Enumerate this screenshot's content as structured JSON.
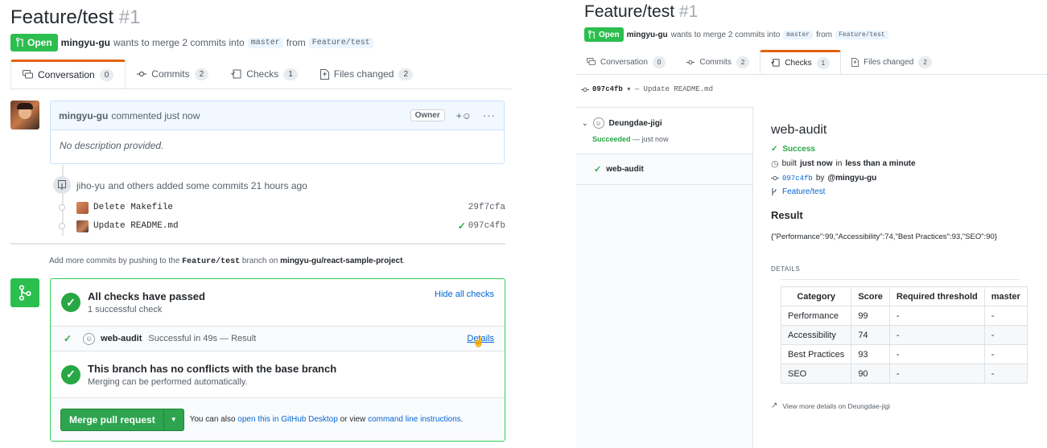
{
  "left": {
    "title": "Feature/test",
    "number": "#1",
    "state_label": "Open",
    "author": "mingyu-gu",
    "merge_text": "wants to merge 2 commits into",
    "base_branch": "master",
    "from_text": "from",
    "head_branch": "Feature/test",
    "tabs": [
      {
        "label": "Conversation",
        "count": "0"
      },
      {
        "label": "Commits",
        "count": "2"
      },
      {
        "label": "Checks",
        "count": "1"
      },
      {
        "label": "Files changed",
        "count": "2"
      }
    ],
    "comment": {
      "author": "mingyu-gu",
      "action": "commented just now",
      "owner_badge": "Owner",
      "body": "No description provided."
    },
    "commits_event": {
      "author": "jiho-yu",
      "text": "and others added some commits 21 hours ago"
    },
    "commits": [
      {
        "message": "Delete Makefile",
        "sha": "29f7cfa",
        "status": ""
      },
      {
        "message": "Update README.md",
        "sha": "097c4fb",
        "status": "success"
      }
    ],
    "push_hint": {
      "prefix": "Add more commits by pushing to the",
      "branch": "Feature/test",
      "middle": "branch on",
      "repo": "mingyu-gu/react-sample-project",
      "suffix": "."
    },
    "checks": {
      "title": "All checks have passed",
      "subtitle": "1 successful check",
      "hide_link": "Hide all checks",
      "item_name": "web-audit",
      "item_status": "Successful in 49s — Result",
      "details_link": "Details"
    },
    "conflicts": {
      "title": "This branch has no conflicts with the base branch",
      "subtitle": "Merging can be performed automatically."
    },
    "merge": {
      "button": "Merge pull request",
      "also_text": "You can also",
      "desktop_link": "open this in GitHub Desktop",
      "or_text": "or view",
      "cli_link": "command line instructions",
      "end": "."
    }
  },
  "right": {
    "title": "Feature/test",
    "number": "#1",
    "state_label": "Open",
    "author": "mingyu-gu",
    "merge_text": "wants to merge 2 commits into",
    "base_branch": "master",
    "from_text": "from",
    "head_branch": "Feature/test",
    "tabs": [
      {
        "label": "Conversation",
        "count": "0"
      },
      {
        "label": "Commits",
        "count": "2"
      },
      {
        "label": "Checks",
        "count": "1"
      },
      {
        "label": "Files changed",
        "count": "2"
      }
    ],
    "commit_selector": {
      "sha": "097c4fb",
      "message": "— Update README.md"
    },
    "suite": {
      "name": "Deungdae-jigi",
      "status": "Succeeded",
      "time": "— just now"
    },
    "run_item": "web-audit",
    "detail": {
      "title": "web-audit",
      "status": "Success",
      "built_prefix": "built",
      "built_when": "just now",
      "built_in": "in",
      "built_duration": "less than a minute",
      "commit_sha": "097c4fb",
      "commit_by": "by",
      "commit_user": "@mingyu-gu",
      "branch": "Feature/test",
      "result_heading": "Result",
      "result_json": "{\"Performance\":99,\"Accessibility\":74,\"Best Practices\":93,\"SEO\":90}",
      "details_heading": "DETAILS",
      "table_headers": [
        "Category",
        "Score",
        "Required threshold",
        "master"
      ],
      "table_rows": [
        [
          "Performance",
          "99",
          "-",
          "-"
        ],
        [
          "Accessibility",
          "74",
          "-",
          "-"
        ],
        [
          "Best Practices",
          "93",
          "-",
          "-"
        ],
        [
          "SEO",
          "90",
          "-",
          "-"
        ]
      ],
      "view_more": "View more details on Deungdae-jigi"
    }
  },
  "colors": {
    "open_green": "#2cbe4e",
    "success_green": "#28a745",
    "link_blue": "#0366d6",
    "active_tab_orange": "#e36209"
  }
}
